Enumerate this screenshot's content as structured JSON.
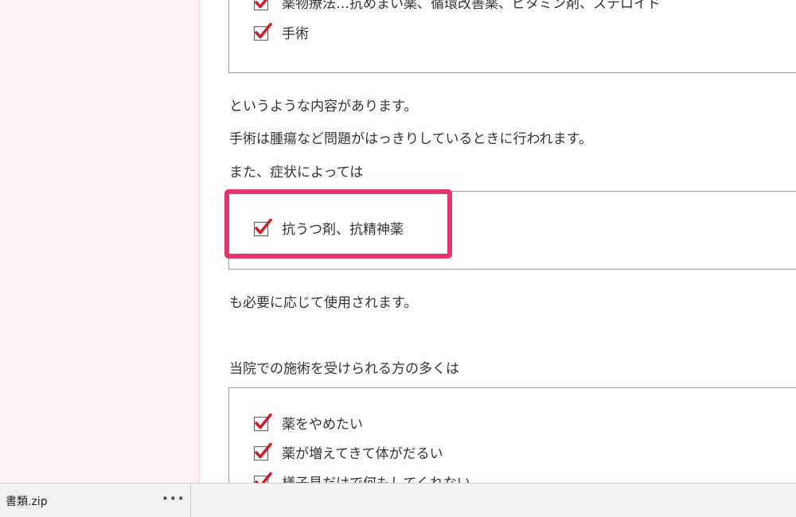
{
  "article": {
    "box1_items": [
      "薬物療法…抗めまい薬、循環改善薬、ビタミン剤、ステロイド",
      "手術"
    ],
    "para1": "というような内容があります。",
    "para2": "手術は腫瘍など問題がはっきりしているときに行われます。",
    "para3": "また、症状によっては",
    "box2_items": [
      "抗うつ剤、抗精神薬"
    ],
    "para4": "も必要に応じて使用されます。",
    "para5": "当院での施術を受けられる方の多くは",
    "box3_items": [
      "薬をやめたい",
      "薬が増えてきて体がだるい",
      "様子見だけで何もしてくれない"
    ]
  },
  "colors": {
    "highlight": "#e8336d",
    "checkmark": "#cc1f2d",
    "sidebar_bg": "#fff3f5"
  },
  "downloads": {
    "file_name": "書類.zip",
    "more_label": "•••"
  }
}
